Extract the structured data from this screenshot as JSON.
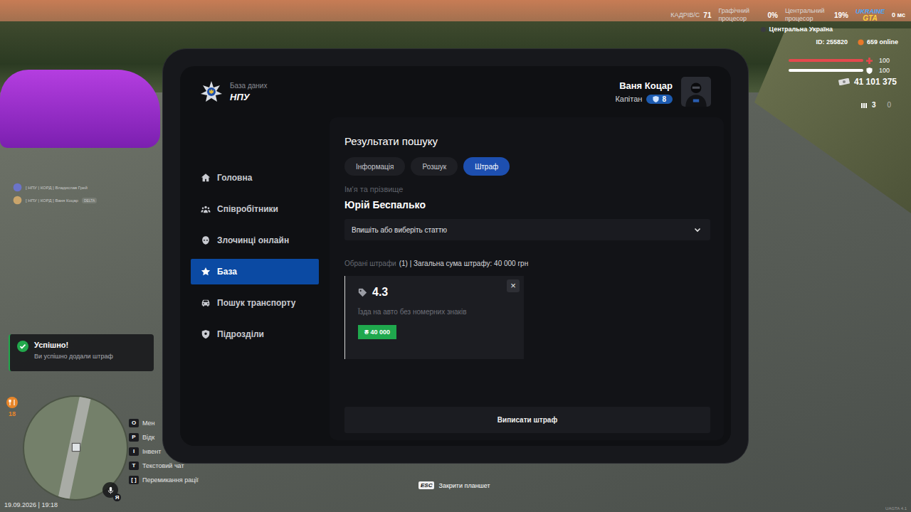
{
  "hud": {
    "perf": [
      {
        "label": "КАДРІВ/С",
        "value": "71"
      },
      {
        "label": "Графічний процесор",
        "value": "0%"
      },
      {
        "label": "Центральний процесор",
        "value": "19%"
      }
    ],
    "region": "Центральна Україна",
    "logo": {
      "line1": "UKRAINE",
      "line2": "GTA"
    },
    "ping": "0 мс",
    "player_id": "ID: 255820",
    "online": "659 online",
    "health": {
      "value": "100",
      "level": 1
    },
    "armor": {
      "value": "100",
      "level": 1
    },
    "money": "41 101 375",
    "ammo": {
      "clip": "3",
      "reserve": "0"
    },
    "chat": [
      {
        "text": "[ НПУ | КОРД ] Владислав Грей",
        "badge": ""
      },
      {
        "text": "[ НПУ | КОРД ] Ваня Коцар",
        "badge": "DELTA"
      }
    ],
    "notification": {
      "title": "Успішно!",
      "message": "Ви успішно додали штраф"
    },
    "hunger": "18",
    "hints": [
      {
        "key": "O",
        "label": "Мен"
      },
      {
        "key": "P",
        "label": "Відк"
      },
      {
        "key": "I",
        "label": "Інвент"
      },
      {
        "key": "T",
        "label": "Текстовий чат"
      },
      {
        "key": "[ ]",
        "label": "Перемикання рації"
      }
    ],
    "date": "19.09.2026 | 19:18",
    "voice_key": "Я",
    "close_hint": {
      "key": "ESC",
      "label": "Закрити планшет"
    },
    "version": "UAGTA 4.1"
  },
  "tablet": {
    "header": {
      "subtitle": "База даних",
      "title": "НПУ"
    },
    "user": {
      "name": "Ваня Коцар",
      "rank": "Капітан",
      "level": "8"
    },
    "sidebar": [
      {
        "label": "Головна",
        "selected": false
      },
      {
        "label": "Співробітники",
        "selected": false
      },
      {
        "label": "Злочинці онлайн",
        "selected": false
      },
      {
        "label": "База",
        "selected": true
      },
      {
        "label": "Пошук транспорту",
        "selected": false
      },
      {
        "label": "Підрозділи",
        "selected": false
      }
    ],
    "title": "Результати пошуку",
    "tabs": [
      {
        "label": "Інформація",
        "selected": false
      },
      {
        "label": "Розшук",
        "selected": false
      },
      {
        "label": "Штраф",
        "selected": true
      }
    ],
    "name_label": "Ім'я та прізвище",
    "name": "Юрій Беспалько",
    "article_select": {
      "placeholder": "Впишіть або виберіть статтю"
    },
    "summary": {
      "label": "Обрані штрафи",
      "rest": "(1) | Загальна сума штрафу: 40 000 грн"
    },
    "fines": [
      {
        "article": "4.3",
        "description": "Їзда на авто без номерних знаків",
        "amount": "₴ 40 000",
        "remove": "×"
      }
    ],
    "submit": "Виписати штраф"
  }
}
